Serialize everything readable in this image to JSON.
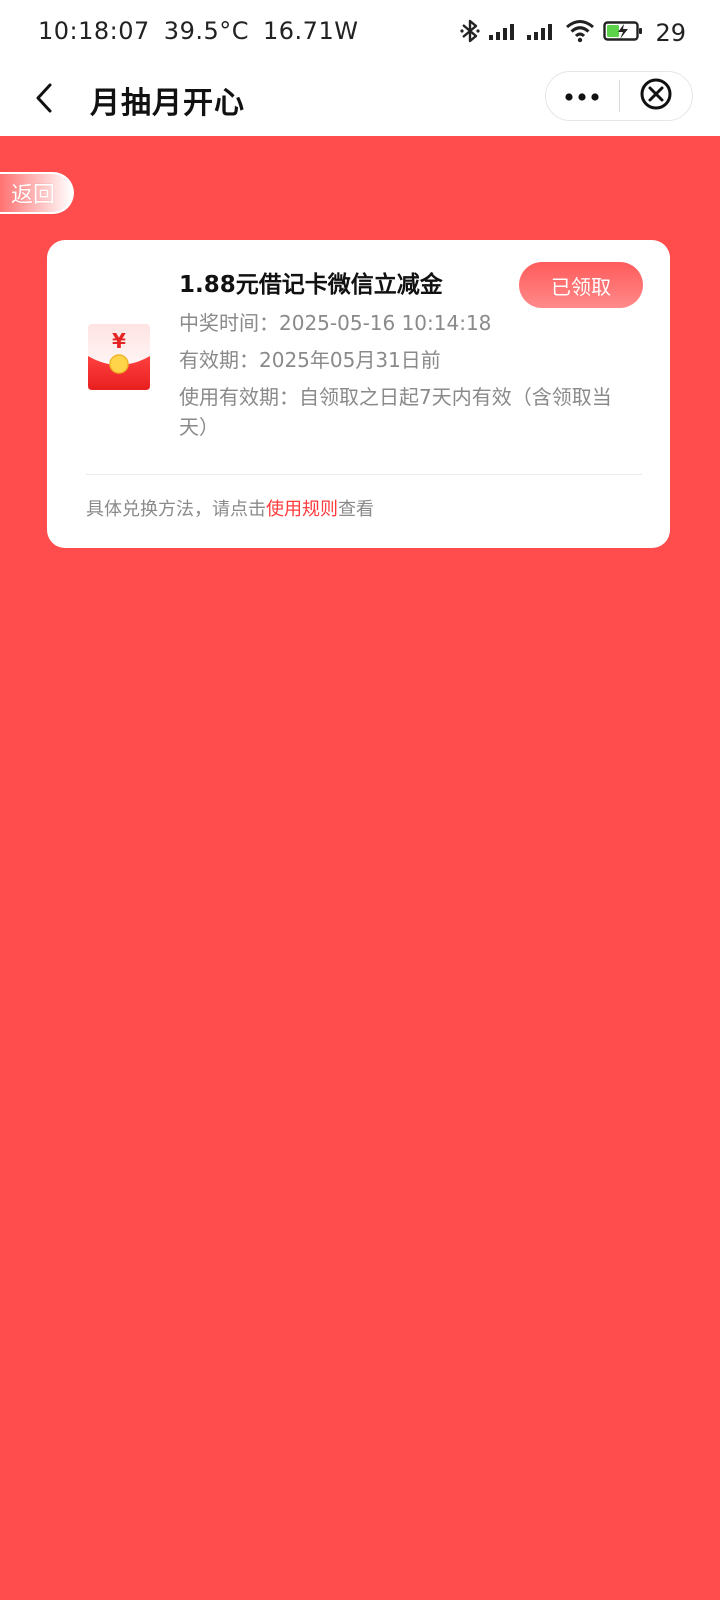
{
  "status_bar": {
    "time": "10:18:07",
    "temperature": "39.5°C",
    "power": "16.71W",
    "battery_level": "29",
    "icons": [
      "bluetooth-icon",
      "signal-icon",
      "signal-icon",
      "wifi-icon",
      "battery-charging-icon"
    ]
  },
  "nav": {
    "title": "月抽月开心",
    "back_icon": "chevron-left-icon",
    "more_icon": "more-dots-icon",
    "close_icon": "close-circle-icon"
  },
  "back_button": {
    "label": "返回"
  },
  "prize_card": {
    "title": "1.88元借记卡微信立减金",
    "status_button": "已领取",
    "win_time": "中奖时间：2025-05-16 10:14:18",
    "validity": "有效期：2025年05月31日前",
    "usage_validity": "使用有效期：自领取之日起7天内有效（含领取当天）",
    "footer_prefix": "具体兑换方法，请点击",
    "footer_link": "使用规则",
    "footer_suffix": "查看",
    "envelope_symbol": "¥"
  },
  "colors": {
    "page_background": "#ff4c4c",
    "accent": "#ff3b3b",
    "card_background": "#ffffff"
  }
}
